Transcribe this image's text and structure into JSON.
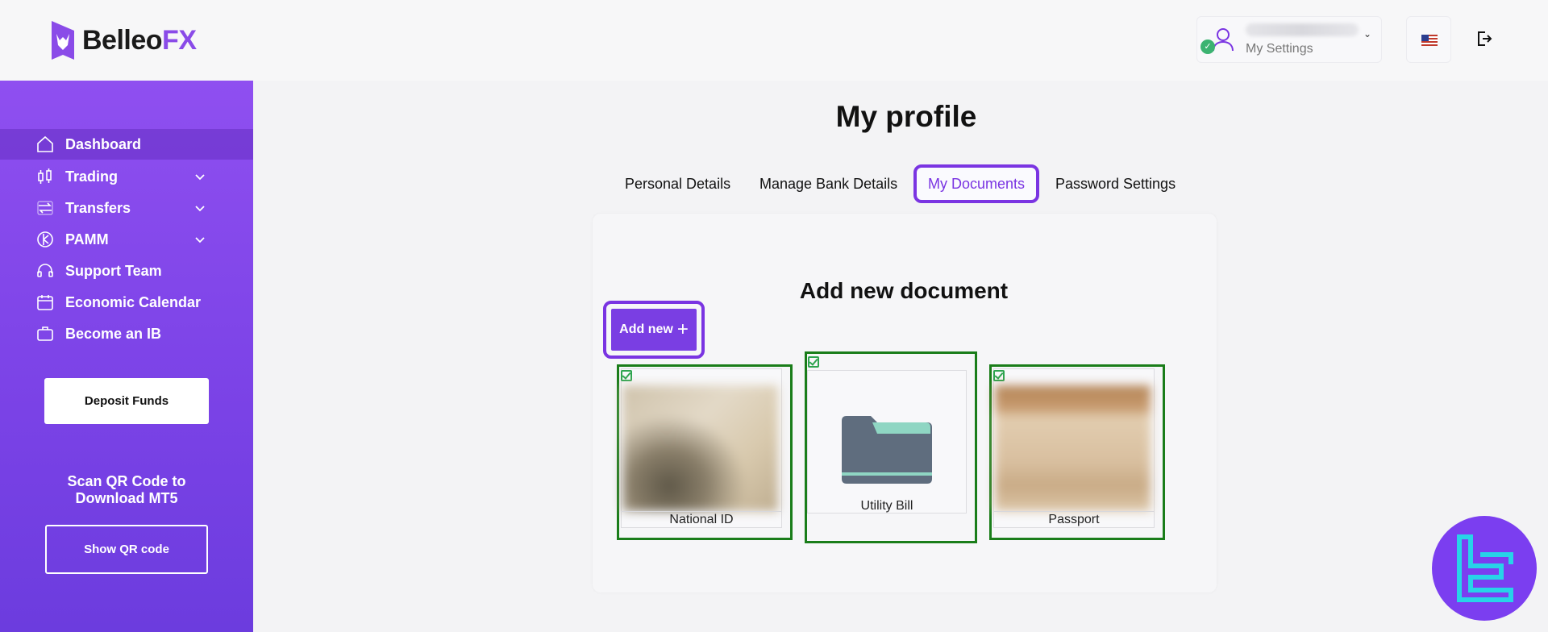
{
  "header": {
    "logo_text_main": "Belleo",
    "logo_text_accent": "FX",
    "settings_label": "My Settings",
    "flag_name": "us-flag-icon",
    "logout_icon": "logout-icon"
  },
  "sidebar": {
    "items": [
      {
        "label": "Dashboard",
        "icon": "home-icon",
        "expandable": false,
        "active": true
      },
      {
        "label": "Trading",
        "icon": "candlestick-icon",
        "expandable": true
      },
      {
        "label": "Transfers",
        "icon": "transfer-icon",
        "expandable": true
      },
      {
        "label": "PAMM",
        "icon": "pamm-icon",
        "expandable": true
      },
      {
        "label": "Support Team",
        "icon": "headset-icon",
        "expandable": false
      },
      {
        "label": "Economic Calendar",
        "icon": "calendar-icon",
        "expandable": false
      },
      {
        "label": "Become an IB",
        "icon": "briefcase-icon",
        "expandable": false
      }
    ],
    "deposit_label": "Deposit Funds",
    "qr_text": "Scan QR Code to Download MT5",
    "qr_button_label": "Show QR code"
  },
  "main": {
    "title": "My profile",
    "tabs": [
      {
        "label": "Personal Details"
      },
      {
        "label": "Manage Bank Details"
      },
      {
        "label": "My Documents",
        "active": true
      },
      {
        "label": "Password Settings"
      }
    ],
    "card_title": "Add new document",
    "add_new_label": "Add new",
    "documents": [
      {
        "label": "National ID",
        "verified": true
      },
      {
        "label": "Utility Bill",
        "verified": true
      },
      {
        "label": "Passport",
        "verified": true
      }
    ]
  },
  "colors": {
    "accent": "#7a34e2",
    "sidebar_top": "#8f4ff0",
    "verified_green": "#1a7d1a"
  }
}
